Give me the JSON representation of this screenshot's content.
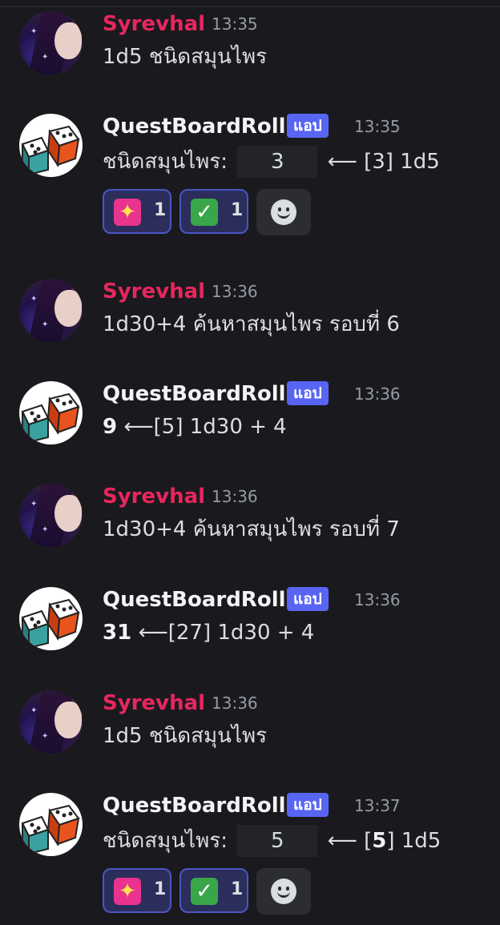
{
  "messages": [
    {
      "author": "Syrevhal",
      "time": "13:35",
      "text": "1d5 ชนิดสมุนไพร"
    },
    {
      "author": "QuestBoardRoll",
      "badge": "แอป",
      "time": "13:35",
      "label": "ชนิดสมุนไพร:",
      "code": "3",
      "rest": "⟵ [3] 1d5",
      "reactions": [
        {
          "emoji": "sparkling-heart-icon",
          "count": "1"
        },
        {
          "emoji": "check-mark-icon",
          "count": "1"
        }
      ]
    },
    {
      "author": "Syrevhal",
      "time": "13:36",
      "text": "1d30+4 ค้นหาสมุนไพร รอบที่ 6"
    },
    {
      "author": "QuestBoardRoll",
      "badge": "แอป",
      "time": "13:36",
      "bold": "9",
      "rest": "⟵[5] 1d30 + 4"
    },
    {
      "author": "Syrevhal",
      "time": "13:36",
      "text": "1d30+4 ค้นหาสมุนไพร รอบที่ 7"
    },
    {
      "author": "QuestBoardRoll",
      "badge": "แอป",
      "time": "13:36",
      "bold": "31",
      "rest": "⟵[27] 1d30 + 4"
    },
    {
      "author": "Syrevhal",
      "time": "13:36",
      "text": "1d5 ชนิดสมุนไพร"
    },
    {
      "author": "QuestBoardRoll",
      "badge": "แอป",
      "time": "13:37",
      "label": "ชนิดสมุนไพร:",
      "code": "5",
      "rest_pre": "⟵ [",
      "rest_bold": "5",
      "rest_post": "] 1d5",
      "reactions": [
        {
          "emoji": "sparkling-heart-icon",
          "count": "1"
        },
        {
          "emoji": "check-mark-icon",
          "count": "1"
        }
      ]
    }
  ],
  "colors": {
    "background": "#1a1a1e",
    "syrevhal_name": "#e8265e",
    "app_badge": "#5865f2",
    "timestamp": "#949ba4"
  }
}
